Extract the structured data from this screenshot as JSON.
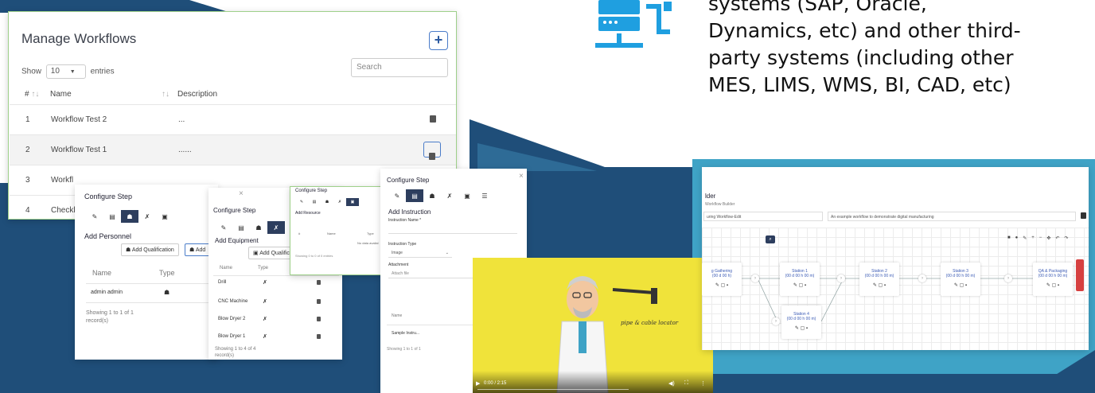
{
  "colors": {
    "slide_dark": "#1f4e79",
    "slide_mid": "#2e6b96",
    "slide_light": "#3fa3c6",
    "accent_blue": "#1f9fe0",
    "panel_dark": "#2d3e5e",
    "danger": "#d64040"
  },
  "blurb": {
    "line1": "systems      (SAP,      Oracle,",
    "line2": "Dynamics, etc) and other third-",
    "line3": "party systems (including other",
    "line4": "MES, LIMS, WMS, BI, CAD, etc)",
    "icon": "server-icon"
  },
  "manage_workflows": {
    "title": "Manage Workflows",
    "add_label": "+",
    "show_label": "Show",
    "entries_value": "10",
    "entries_label": "entries",
    "search_placeholder": "Search",
    "columns": [
      "#",
      "Name",
      "Description"
    ],
    "rows": [
      {
        "num": "1",
        "name": "Workflow Test 2",
        "desc": "..."
      },
      {
        "num": "2",
        "name": "Workflow Test 1",
        "desc": "......"
      },
      {
        "num": "3",
        "name": "Workfl",
        "desc": ""
      },
      {
        "num": "4",
        "name": "Checkl",
        "desc": ""
      }
    ]
  },
  "personnel": {
    "title": "Configure Step",
    "section": "Add Personnel",
    "add_qualification": "Add Qualification",
    "add_short": "Add",
    "columns": [
      "Name",
      "Type"
    ],
    "row_name": "admin admin",
    "footer": "Showing 1 to 1 of 1",
    "footer2": "record(s)"
  },
  "equipment": {
    "title": "Configure Step",
    "close": "×",
    "section": "Add Equipment",
    "add_qualification": "Add Qualification",
    "columns": [
      "Name",
      "Type"
    ],
    "rows": [
      "Drill",
      "CNC Machine",
      "Blow Dryer 2",
      "Blow Dryer 1"
    ],
    "footer": "Showing 1 to 4 of 4",
    "footer2": "record(s)"
  },
  "resource": {
    "title": "Configure Step",
    "section": "Add Resource",
    "col1": "#",
    "col2": "Name",
    "col3": "Type",
    "empty": "No data availal",
    "footer": "Showing 0 to 0 of 0 entries"
  },
  "instruction": {
    "title": "Configure Step",
    "close": "×",
    "section": "Add Instruction",
    "name_label": "Instruction Name *",
    "type_label": "Instruction Type",
    "type_value": "Image",
    "attachment_label": "Attachment",
    "attach_placeholder": "Attach file",
    "col_name": "Name",
    "row_name": "Sample Instru...",
    "footer": "Showing 1 to 1 of 1"
  },
  "video": {
    "time": "0:00 / 2:15",
    "label": "pipe & cable locator"
  },
  "builder": {
    "title": "lder",
    "subtitle": "Workflow Builder",
    "name_value": "uring Workflow-Edit",
    "desc_value": "An example workflow to demonstrate digital manufacturing",
    "close": "×",
    "nodes": [
      {
        "name": "g Gathering",
        "sub": "(00 d 00 h)"
      },
      {
        "name": "Station 1",
        "sub": "(00 d 00 h 00 m)"
      },
      {
        "name": "Station 2",
        "sub": "(00 d 00 h 00 m)"
      },
      {
        "name": "Station 3",
        "sub": "(00 d 00 h 00 m)"
      },
      {
        "name": "QA & Packaging",
        "sub": "(00 d 00 h 00 m)"
      },
      {
        "name": "Station 4",
        "sub": "(00 d 00 h 00 m)"
      }
    ],
    "toolbar": [
      "■",
      "●",
      "✎",
      "+",
      "−",
      "✥",
      "↶",
      "↷"
    ]
  }
}
